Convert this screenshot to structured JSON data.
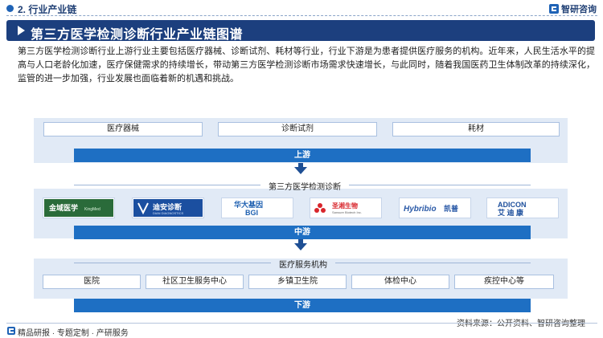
{
  "header": {
    "section_title": "2. 行业产业链",
    "brand_name": "智研咨询"
  },
  "banner": {
    "title": "第三方医学检测诊断行业产业链图谱"
  },
  "intro": "第三方医学检测诊断行业上游行业主要包括医疗器械、诊断试剂、耗材等行业，行业下游是为患者提供医疗服务的机构。近年来，人民生活水平的提高与人口老龄化加速，医疗保健需求的持续增长，带动第三方医学检测诊断市场需求快速增长，与此同时，随着我国医药卫生体制改革的持续深化，监管的进一步加强，行业发展也面临着新的机遇和挑战。",
  "upstream": {
    "items": [
      "医疗器械",
      "诊断试剂",
      "耗材"
    ],
    "label": "上游"
  },
  "midstream": {
    "title": "第三方医学检测诊断",
    "companies": [
      {
        "name": "金域医学",
        "sub": "KingMed Diagnostics"
      },
      {
        "name": "迪安诊断",
        "sub": "DIAN DIAGNOSTICS"
      },
      {
        "name": "华大基因",
        "sub": "BGI"
      },
      {
        "name": "圣湘生物",
        "sub": "Sansure Biotech Inc."
      },
      {
        "name": "Hybribio凯普",
        "sub": ""
      },
      {
        "name": "ADICON",
        "sub": "艾迪康"
      }
    ],
    "label": "中游"
  },
  "downstream": {
    "title": "医疗服务机构",
    "items": [
      "医院",
      "社区卫生服务中心",
      "乡镇卫生院",
      "体检中心",
      "疾控中心等"
    ],
    "label": "下游"
  },
  "footer": {
    "tagline": "精品研报 · 专题定制 · 产研服务",
    "source": "资料来源：公开资料、智研咨询整理"
  },
  "colors": {
    "navy": "#1c3f7e",
    "bar_blue": "#1e6fc3",
    "band_bg": "#e1eaf6"
  }
}
